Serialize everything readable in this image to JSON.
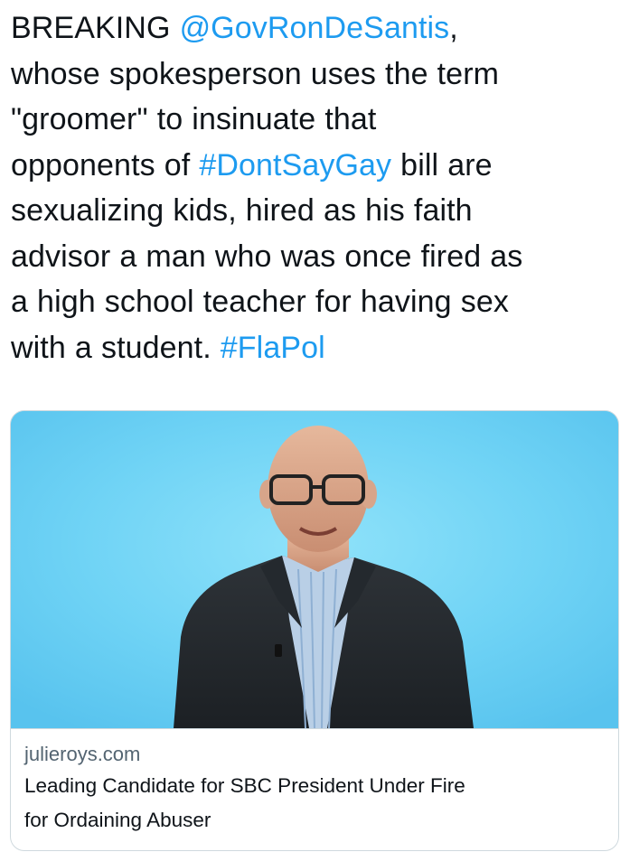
{
  "tweet": {
    "lines": [
      [
        {
          "text": "BREAKING ",
          "type": "text"
        },
        {
          "text": "@GovRonDeSantis",
          "type": "mention"
        },
        {
          "text": ",",
          "type": "text"
        }
      ],
      [
        {
          "text": "whose spokesperson uses the term",
          "type": "text"
        }
      ],
      [
        {
          "text": "\"groomer\" to insinuate that",
          "type": "text"
        }
      ],
      [
        {
          "text": "opponents of ",
          "type": "text"
        },
        {
          "text": "#DontSayGay",
          "type": "hashtag"
        },
        {
          "text": " bill are",
          "type": "text"
        }
      ],
      [
        {
          "text": "sexualizing kids, hired as his faith",
          "type": "text"
        }
      ],
      [
        {
          "text": "advisor a man who was once fired as",
          "type": "text"
        }
      ],
      [
        {
          "text": "a high school teacher for having sex",
          "type": "text"
        }
      ],
      [
        {
          "text": "with a student. ",
          "type": "text"
        },
        {
          "text": "#FlaPol",
          "type": "hashtag"
        }
      ]
    ]
  },
  "link_card": {
    "image_icon": "man-in-suit-portrait",
    "domain": "julieroys.com",
    "title_lines": [
      "Leading Candidate for SBC President Under Fire",
      "for Ordaining Abuser"
    ]
  },
  "colors": {
    "link": "#1d9bf0",
    "text": "#0f1419",
    "secondary": "#536471",
    "border": "#cfd9de",
    "image_background": "#6fd3f5"
  }
}
